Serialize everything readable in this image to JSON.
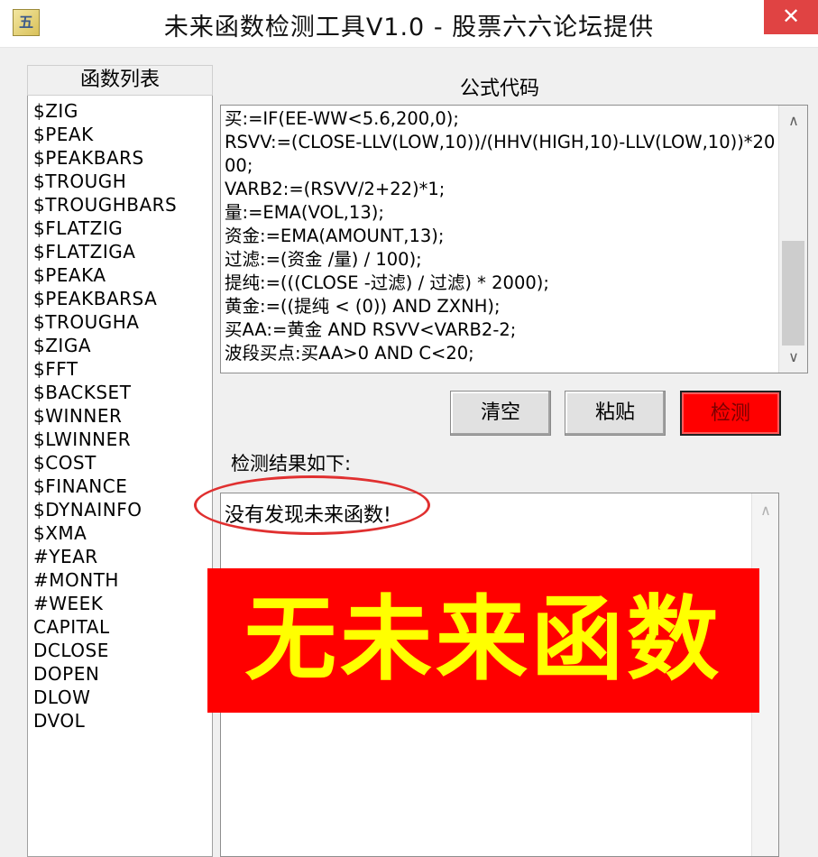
{
  "window": {
    "title": "未来函数检测工具V1.0 - 股票六六论坛提供",
    "icon_glyph": "五",
    "close_glyph": "✕"
  },
  "function_list": {
    "header": "函数列表",
    "items": [
      "$ZIG",
      "$PEAK",
      "$PEAKBARS",
      "$TROUGH",
      "$TROUGHBARS",
      "$FLATZIG",
      "$FLATZIGA",
      "$PEAKA",
      "$PEAKBARSA",
      "$TROUGHA",
      "$ZIGA",
      "$FFT",
      "$BACKSET",
      "$WINNER",
      "$LWINNER",
      "$COST",
      "$FINANCE",
      "$DYNAINFO",
      "$XMA",
      "#YEAR",
      "#MONTH",
      "#WEEK",
      "CAPITAL",
      "DCLOSE",
      "DOPEN",
      "DLOW",
      "DVOL"
    ]
  },
  "formula": {
    "label": "公式代码",
    "lines": [
      "买:=IF(EE-WW<5.6,200,0);",
      "RSVV:=(CLOSE-LLV(LOW,10))/(HHV(HIGH,10)-LLV(LOW,10))*2000;",
      "VARB2:=(RSVV/2+22)*1;",
      "量:=EMA(VOL,13);",
      "资金:=EMA(AMOUNT,13);",
      "过滤:=(资金 /量) / 100);",
      "提纯:=(((CLOSE -过滤) / 过滤) * 2000);",
      "黄金:=((提纯 < (0)) AND ZXNH);",
      "买AA:=黄金 AND RSVV<VARB2-2;",
      "波段买点:买AA>0 AND C<20;"
    ],
    "scroll": {
      "up_icon": "chevron-up",
      "down_icon": "chevron-down"
    }
  },
  "buttons": {
    "clear": "清空",
    "paste": "粘贴",
    "detect": "检测"
  },
  "result": {
    "label": "检测结果如下:",
    "text": "没有发现未来函数!"
  },
  "banner": {
    "text": "无未来函数",
    "background": "#ff0000",
    "color": "#ffff00"
  }
}
